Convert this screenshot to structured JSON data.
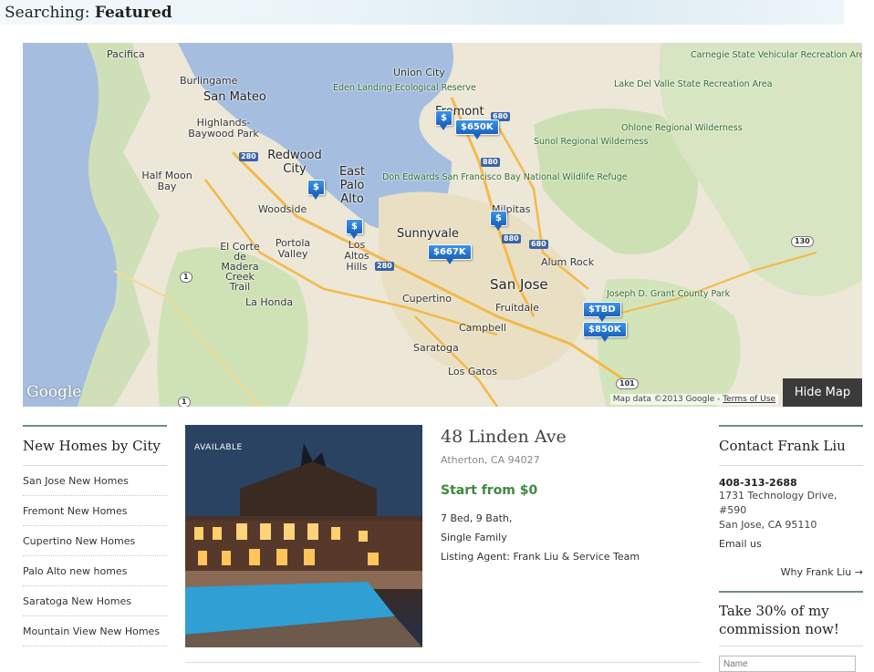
{
  "header": {
    "label": "Searching:",
    "value": "Featured"
  },
  "map": {
    "places": {
      "pacifica": "Pacifica",
      "burlingame": "Burlingame",
      "san_mateo": "San Mateo",
      "highlands": "Highlands-Baywood Park",
      "redwood_city": "Redwood City",
      "half_moon_bay": "Half Moon Bay",
      "woodside": "Woodside",
      "east_palo_alto": "East Palo Alto",
      "el_corte": "El Corte de Madera Creek Trail",
      "portola_valley": "Portola Valley",
      "los_altos_hills": "Los Altos Hills",
      "la_honda": "La Honda",
      "union_city": "Union City",
      "eden_landing": "Eden Landing Ecological Reserve",
      "fremont": "Fremont",
      "don_edwards": "Don Edwards San Francisco Bay National Wildlife Refuge",
      "sunnyvale": "Sunnyvale",
      "milpitas": "Milpitas",
      "san_jose": "San Jose",
      "cupertino": "Cupertino",
      "fruitdale": "Fruitdale",
      "campbell": "Campbell",
      "saratoga": "Saratoga",
      "los_gatos": "Los Gatos",
      "alum_rock": "Alum Rock",
      "joseph_grant": "Joseph D. Grant County Park",
      "carnegie": "Carnegie State Vehicular Recreation Area",
      "lake_del_valle": "Lake Del Valle State Recreation Area",
      "ohlone": "Ohlone Regional Wilderness",
      "sunol": "Sunol Regional Wilderness"
    },
    "highways": [
      "280",
      "880",
      "680",
      "280",
      "880",
      "680",
      "1",
      "101",
      "130",
      "1"
    ],
    "pins": [
      "$",
      "$650K",
      "$",
      "$",
      "$",
      "$667K",
      "$TBD",
      "$850K"
    ],
    "logo": "Google",
    "attribution": "Map data ©2013 Google -",
    "terms": "Terms of Use",
    "hide_label": "Hide Map"
  },
  "sidebar": {
    "title": "New Homes by City",
    "items": [
      "San Jose New Homes",
      "Fremont New Homes",
      "Cupertino New Homes",
      "Palo Alto new homes",
      "Saratoga New Homes",
      "Mountain View New Homes"
    ]
  },
  "listing": {
    "badge": "AVAILABLE",
    "address": "48 Linden Ave",
    "city": "Atherton, CA 94027",
    "price": "Start from $0",
    "beds_baths": "7 Bed, 9 Bath,",
    "type": "Single Family",
    "agent": "Listing Agent: Frank Liu & Service Team"
  },
  "contact": {
    "title": "Contact Frank Liu",
    "phone": "408-313-2688",
    "street": "1731 Technology Drive, #590",
    "city": "San Jose, CA 95110",
    "email": "Email us",
    "why": "Why Frank Liu →"
  },
  "promo": {
    "title": "Take 30% of my commission now!",
    "name_placeholder": "Name"
  }
}
